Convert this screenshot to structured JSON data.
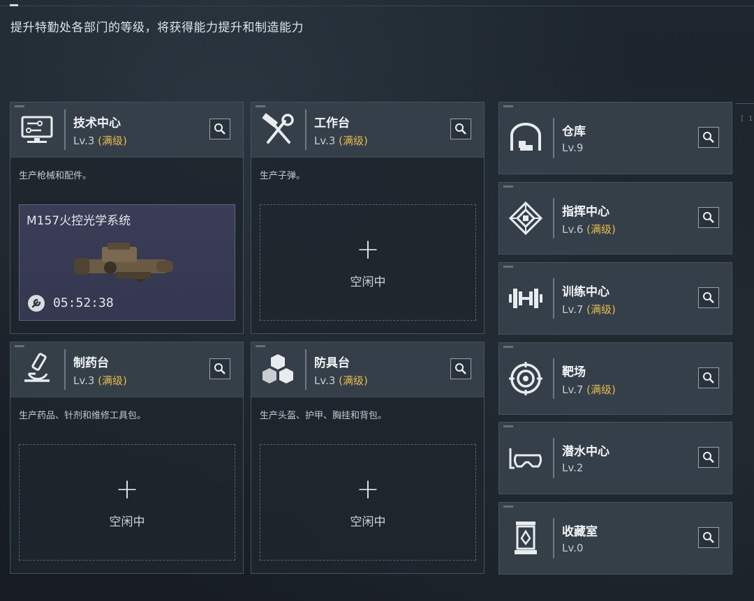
{
  "header": {
    "subtitle": "提升特勤处各部门的等级，将获得能力提升和制造能力",
    "deco_text": "[ 1"
  },
  "colors": {
    "max_level": "#e5bb4e",
    "panel": "#3a444e",
    "accent_slot": "#3b3d57"
  },
  "big_cards": [
    {
      "name": "技术中心",
      "level": "Lv.3",
      "max": "(满级)",
      "icon": "computer-icon",
      "desc": "生产枪械和配件。",
      "slot": {
        "state": "active",
        "item": "M157火控光学系统",
        "timer": "05:52:38"
      }
    },
    {
      "name": "工作台",
      "level": "Lv.3",
      "max": "(满级)",
      "icon": "hammer-wrench-icon",
      "desc": "生产子弹。",
      "slot": {
        "state": "empty",
        "plus": "+",
        "idle": "空闲中"
      }
    },
    {
      "name": "制药台",
      "level": "Lv.3",
      "max": "(满级)",
      "icon": "microscope-icon",
      "desc": "生产药品、针剂和维修工具包。",
      "slot": {
        "state": "empty",
        "plus": "+",
        "idle": "空闲中"
      }
    },
    {
      "name": "防具台",
      "level": "Lv.3",
      "max": "(满级)",
      "icon": "armor-boxes-icon",
      "desc": "生产头盔、护甲、胸挂和背包。",
      "slot": {
        "state": "empty",
        "plus": "+",
        "idle": "空闲中"
      }
    }
  ],
  "small_cards": [
    {
      "name": "仓库",
      "level": "Lv.9",
      "max": "",
      "icon": "warehouse-icon"
    },
    {
      "name": "指挥中心",
      "level": "Lv.6",
      "max": "(满级)",
      "icon": "command-chip-icon"
    },
    {
      "name": "训练中心",
      "level": "Lv.7",
      "max": "(满级)",
      "icon": "dumbbell-icon"
    },
    {
      "name": "靶场",
      "level": "Lv.7",
      "max": "(满级)",
      "icon": "target-icon"
    },
    {
      "name": "潜水中心",
      "level": "Lv.2",
      "max": "",
      "icon": "diving-mask-icon"
    },
    {
      "name": "收藏室",
      "level": "Lv.0",
      "max": "",
      "icon": "display-case-icon"
    }
  ]
}
